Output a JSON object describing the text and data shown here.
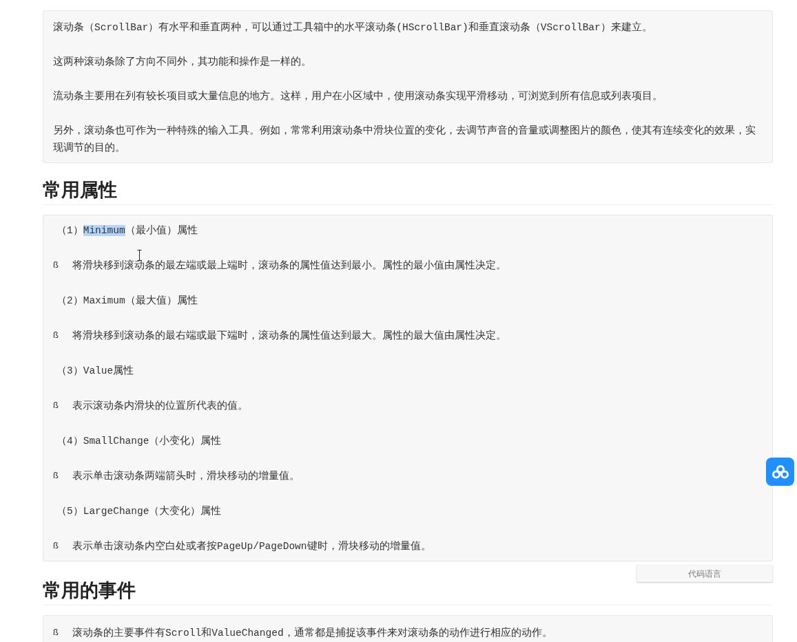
{
  "intro_block": {
    "paragraphs": [
      "滚动条（ScrollBar）有水平和垂直两种，可以通过工具箱中的水平滚动条(HScrollBar)和垂直滚动条（VScrollBar）来建立。",
      "这两种滚动条除了方向不同外，其功能和操作是一样的。",
      "流动条主要用在列有较长项目或大量信息的地方。这样，用户在小区域中，使用滚动条实现平滑移动，可浏览到所有信息或列表项目。",
      "另外，滚动条也可作为一种特殊的输入工具。例如，常常利用滚动条中滑块位置的变化，去调节声音的音量或调整图片的颜色，使其有连续变化的效果，实现调节的目的。"
    ]
  },
  "section_1": {
    "heading": "常用属性",
    "lines": [
      {
        "kind": "item",
        "segments": [
          {
            "text": "（1）",
            "selected": false
          },
          {
            "text": "Minimum",
            "selected": true
          },
          {
            "text": "（最小值）属性",
            "selected": false
          }
        ]
      },
      {
        "kind": "bullet",
        "marker": "ß",
        "text": "将滑块移到滚动条的最左端或最上端时，滚动条的属性值达到最小。属性的最小值由属性决定。"
      },
      {
        "kind": "item",
        "segments": [
          {
            "text": "（2）Maximum（最大值）属性",
            "selected": false
          }
        ]
      },
      {
        "kind": "bullet",
        "marker": "ß",
        "text": "将滑块移到滚动条的最右端或最下端时，滚动条的属性值达到最大。属性的最大值由属性决定。"
      },
      {
        "kind": "item",
        "segments": [
          {
            "text": "（3）Value属性",
            "selected": false
          }
        ]
      },
      {
        "kind": "bullet",
        "marker": "ß",
        "text": "表示滚动条内滑块的位置所代表的值。"
      },
      {
        "kind": "item",
        "segments": [
          {
            "text": "（4）SmallChange（小变化）属性",
            "selected": false
          }
        ]
      },
      {
        "kind": "bullet",
        "marker": "ß",
        "text": "表示单击滚动条两端箭头时，滑块移动的增量值。"
      },
      {
        "kind": "item",
        "segments": [
          {
            "text": "（5）LargeChange（大变化）属性",
            "selected": false
          }
        ]
      },
      {
        "kind": "bullet",
        "marker": "ß",
        "text": "表示单击滚动条内空白处或者按PageUp/PageDown键时，滑块移动的增量值。"
      }
    ]
  },
  "code_language_button": "代码语言",
  "section_2": {
    "heading": "常用的事件",
    "lines": [
      {
        "kind": "bullet",
        "marker": "ß",
        "text": "滚动条的主要事件有Scroll和ValueChanged，通常都是捕捉该事件来对滚动条的动作进行相应的动作。"
      }
    ]
  }
}
